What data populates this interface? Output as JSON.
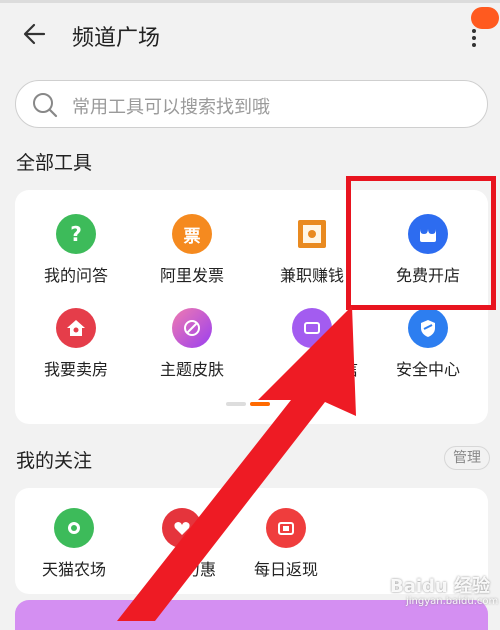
{
  "header": {
    "title": "频道广场",
    "badge": ""
  },
  "search": {
    "placeholder": "常用工具可以搜索找到哦"
  },
  "all_tools": {
    "title": "全部工具",
    "items": [
      {
        "label": "我的问答",
        "icon": "question-icon",
        "color": "#3dbb5a",
        "glyph": "?"
      },
      {
        "label": "阿里发票",
        "icon": "invoice-icon",
        "color": "#f58a1f",
        "glyph": "票"
      },
      {
        "label": "兼职赚钱",
        "icon": "briefcase-icon",
        "color": "#f0a020",
        "glyph": ""
      },
      {
        "label": "免费开店",
        "icon": "shop-icon",
        "color": "#2d6cf0",
        "glyph": ""
      },
      {
        "label": "我要卖房",
        "icon": "house-icon",
        "color": "#e53d4a",
        "glyph": ""
      },
      {
        "label": "主题皮肤",
        "icon": "palette-icon",
        "color": "#c04be0",
        "glyph": ""
      },
      {
        "label": "信",
        "icon": "tv-icon",
        "color": "#a35cf0",
        "glyph": ""
      },
      {
        "label": "安全中心",
        "icon": "shield-icon",
        "color": "#2d7ef0",
        "glyph": ""
      }
    ]
  },
  "follow": {
    "title": "我的关注",
    "manage_label": "管理",
    "items": [
      {
        "label": "天猫农场",
        "icon": "farm-icon",
        "color": "#3dbb5a"
      },
      {
        "label": "力惠",
        "icon": "heart-icon",
        "color": "#e5343c"
      },
      {
        "label": "每日返现",
        "icon": "cashback-icon",
        "color": "#ef3d3d"
      }
    ]
  },
  "watermark": {
    "text": "Baidu 经验",
    "sub": "jingyan.baidu.com"
  },
  "colors": {
    "accent": "#ff6a00",
    "highlight": "#e8141f"
  }
}
